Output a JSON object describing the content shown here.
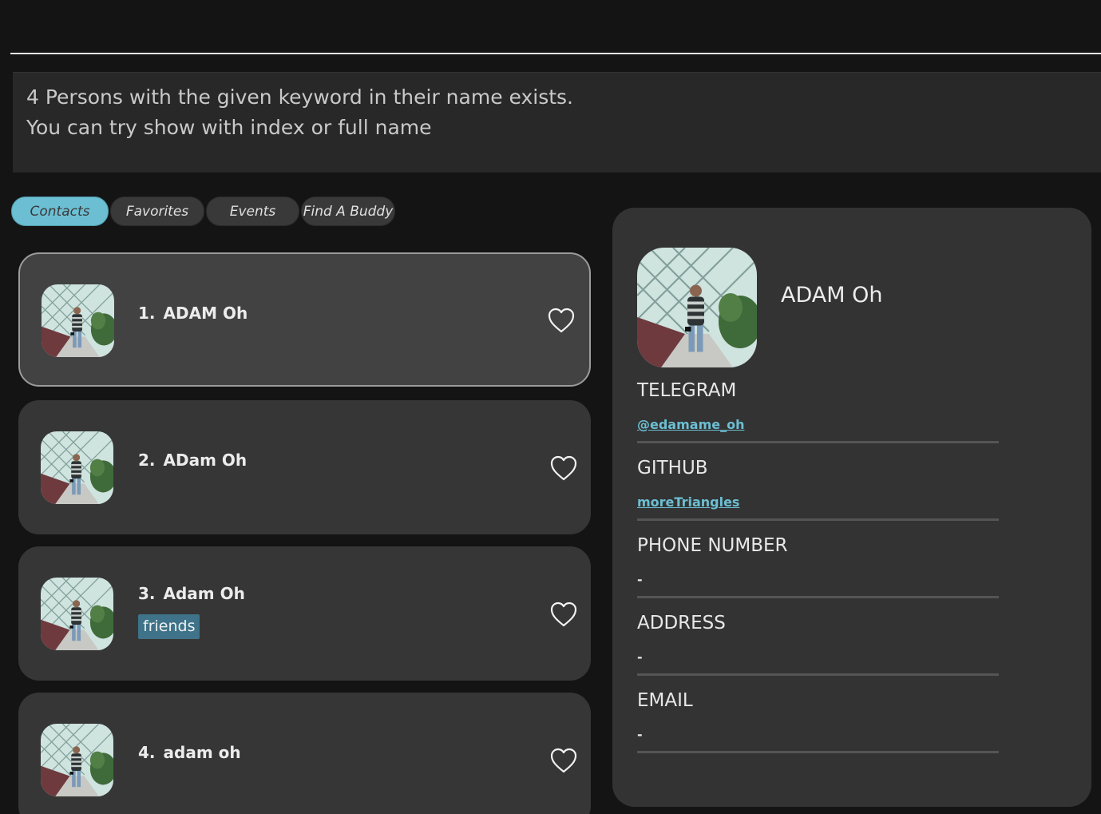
{
  "result": {
    "line1": "4 Persons with the given keyword in their name exists.",
    "line2": "You can try show with index or full name"
  },
  "tabs": [
    {
      "label": "Contacts"
    },
    {
      "label": "Favorites"
    },
    {
      "label": "Events"
    },
    {
      "label": "Find A Buddy"
    }
  ],
  "active_tab": "Contacts",
  "contacts": [
    {
      "index": "1.",
      "name": "ADAM Oh",
      "tag": ""
    },
    {
      "index": "2.",
      "name": "ADam Oh",
      "tag": ""
    },
    {
      "index": "3.",
      "name": "Adam Oh",
      "tag": "friends"
    },
    {
      "index": "4.",
      "name": "adam oh",
      "tag": ""
    }
  ],
  "detail": {
    "name": "ADAM Oh",
    "fields": [
      {
        "label": "TELEGRAM",
        "value": "@edamame_oh",
        "link": true
      },
      {
        "label": "GITHUB",
        "value": "moreTriangles",
        "link": true
      },
      {
        "label": "PHONE NUMBER",
        "value": "-",
        "link": false
      },
      {
        "label": "ADDRESS",
        "value": "-",
        "link": false
      },
      {
        "label": "EMAIL",
        "value": "-",
        "link": false
      }
    ]
  },
  "colors": {
    "accent": "#6cbfd3",
    "tag": "#3e7389",
    "background": "#141414",
    "card": "#363636",
    "panel": "#333333"
  },
  "icons": {
    "favorite": "heart-outline-icon",
    "avatar": "profile-photo"
  }
}
